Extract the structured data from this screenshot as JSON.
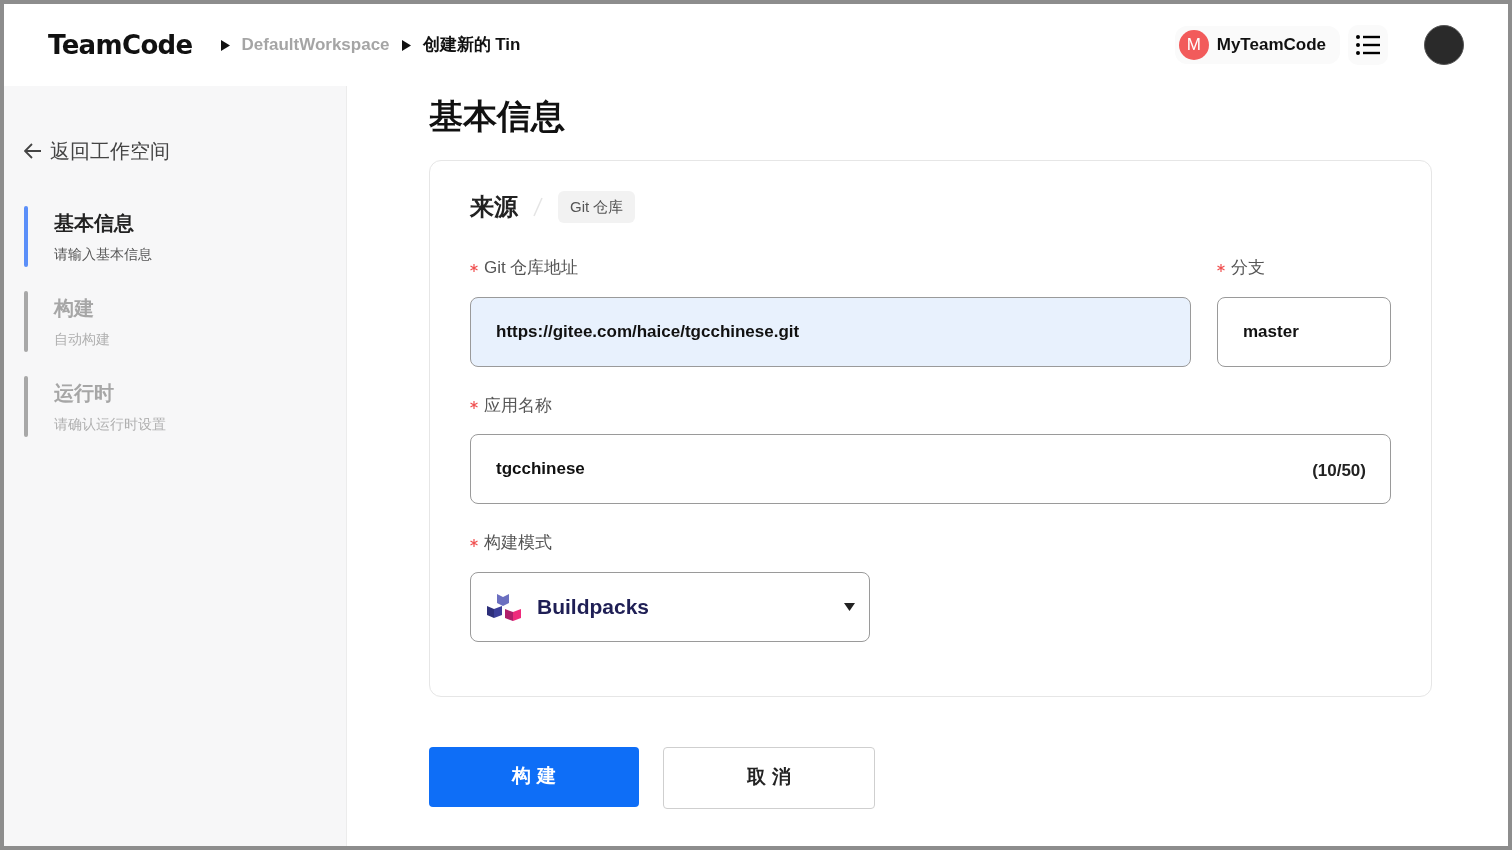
{
  "header": {
    "logo": "TeamCode",
    "breadcrumbs": [
      {
        "label": "DefaultWorkspace",
        "current": false
      },
      {
        "label": "创建新的 Tin",
        "current": true
      }
    ],
    "org": {
      "initial": "M",
      "name": "MyTeamCode"
    }
  },
  "sidebar": {
    "back": "返回工作空间",
    "steps": [
      {
        "title": "基本信息",
        "subtitle": "请输入基本信息",
        "selected": true
      },
      {
        "title": "构建",
        "subtitle": "自动构建",
        "selected": false
      },
      {
        "title": "运行时",
        "subtitle": "请确认运行时设置",
        "selected": false
      }
    ]
  },
  "page_title": "基本信息",
  "form": {
    "source": {
      "title": "来源",
      "tag": "Git 仓库"
    },
    "repo": {
      "label": "Git 仓库地址",
      "required": true,
      "value": "https://gitee.com/haice/tgcchinese.git",
      "focused": true
    },
    "branch": {
      "label": "分支",
      "required": true,
      "value": "master",
      "focused": false
    },
    "app_name": {
      "label": "应用名称",
      "required": true,
      "value": "tgcchinese",
      "counter": "(10/50)",
      "focused": false
    },
    "build_mode": {
      "label": "构建模式",
      "required": true,
      "value": "Buildpacks"
    }
  },
  "buttons": [
    {
      "label": "构 建",
      "kind": "primary"
    },
    {
      "label": "取 消",
      "kind": "secondary"
    }
  ]
}
